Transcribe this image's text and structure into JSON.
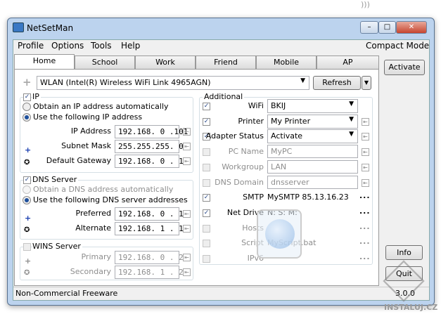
{
  "window": {
    "title": "NetSetMan",
    "minimize": "–",
    "maximize": "□",
    "close": "✕"
  },
  "menu": [
    "Profile",
    "Options",
    "Tools",
    "Help"
  ],
  "compact_mode": "Compact Mode",
  "tabs": [
    "Home",
    "School",
    "Work",
    "Friend",
    "Mobile",
    "AP"
  ],
  "adapter": {
    "selected": "WLAN (Intel(R) Wireless WiFi Link 4965AGN)",
    "refresh": "Refresh"
  },
  "ip": {
    "title": "IP",
    "auto": "Obtain an IP address automatically",
    "manual": "Use the following IP address",
    "fields": [
      {
        "label": "IP Address",
        "value": "192.168. 0 .101"
      },
      {
        "label": "Subnet Mask",
        "value": "255.255.255. 0"
      },
      {
        "label": "Default Gateway",
        "value": "192.168. 0 . 1"
      }
    ]
  },
  "dns": {
    "title": "DNS Server",
    "auto": "Obtain a DNS address automatically",
    "manual": "Use the following DNS server addresses",
    "fields": [
      {
        "label": "Preferred",
        "value": "192.168. 0 . 1"
      },
      {
        "label": "Alternate",
        "value": "192.168. 1 . 1"
      }
    ]
  },
  "wins": {
    "title": "WINS Server",
    "fields": [
      {
        "label": "Primary",
        "value": "192.168. 0 . 2"
      },
      {
        "label": "Secondary",
        "value": "192.168. 1 . 2"
      }
    ]
  },
  "additional": {
    "title": "Additional",
    "items": [
      {
        "label": "WiFi",
        "value": "BKIJ",
        "checked": true
      },
      {
        "label": "Printer",
        "value": "My Printer",
        "checked": true
      },
      {
        "label": "Adapter Status",
        "value": "Activate",
        "checked": true
      },
      {
        "label": "PC Name",
        "value": "MyPC",
        "checked": false
      },
      {
        "label": "Workgroup",
        "value": "LAN",
        "checked": false
      },
      {
        "label": "DNS Domain",
        "value": "dnsserver",
        "checked": false
      },
      {
        "label": "SMTP",
        "value": "MySMTP 85.13.16.23",
        "checked": true
      },
      {
        "label": "Net Drive",
        "value": "N: S: M:",
        "checked": true
      },
      {
        "label": "Hosts",
        "value": "",
        "checked": false
      },
      {
        "label": "Script",
        "value": "MyScript.bat",
        "checked": false
      },
      {
        "label": "IPv6",
        "value": "",
        "checked": false
      }
    ],
    "more": "..."
  },
  "side": {
    "activate": "Activate",
    "info": "Info",
    "quit": "Quit"
  },
  "status": {
    "license": "Non-Commercial Freeware",
    "version": "3.0.0"
  },
  "watermark": "INSTALUJ.CZ"
}
